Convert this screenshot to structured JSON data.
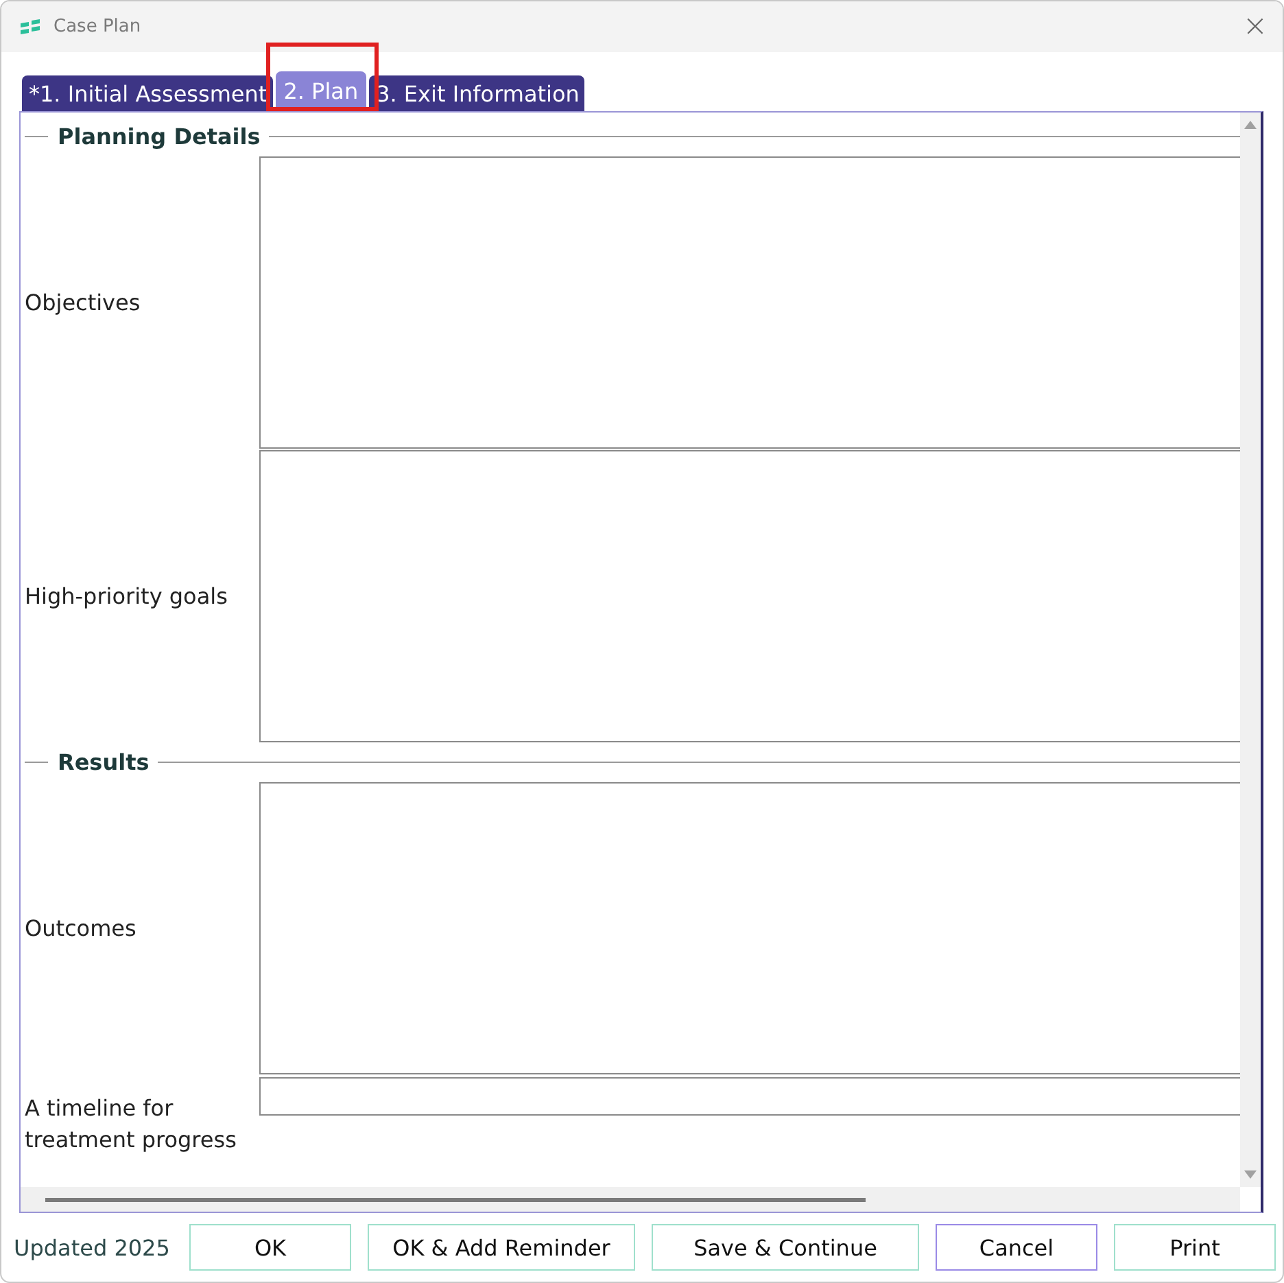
{
  "window": {
    "title": "Case Plan",
    "close": "×"
  },
  "tabs": [
    {
      "label": "*1. Initial Assessment",
      "selected": false
    },
    {
      "label": "2. Plan",
      "selected": true,
      "highlighted": true
    },
    {
      "label": "3. Exit Information",
      "selected": false
    }
  ],
  "sections": [
    {
      "title": "Planning Details",
      "fields": [
        {
          "label": "Objectives",
          "kind": "textarea"
        },
        {
          "label": "High-priority goals",
          "kind": "textarea"
        }
      ]
    },
    {
      "title": "Results",
      "fields": [
        {
          "label": "Outcomes",
          "kind": "textarea"
        },
        {
          "label": "A timeline for treatment progress",
          "kind": "line"
        }
      ]
    }
  ],
  "status": "Updated 2025",
  "buttons": [
    {
      "label": "OK",
      "focused": false
    },
    {
      "label": "OK & Add Reminder",
      "focused": false
    },
    {
      "label": "Save & Continue",
      "focused": false
    },
    {
      "label": "Cancel",
      "focused": true
    },
    {
      "label": "Print",
      "focused": false
    }
  ]
}
